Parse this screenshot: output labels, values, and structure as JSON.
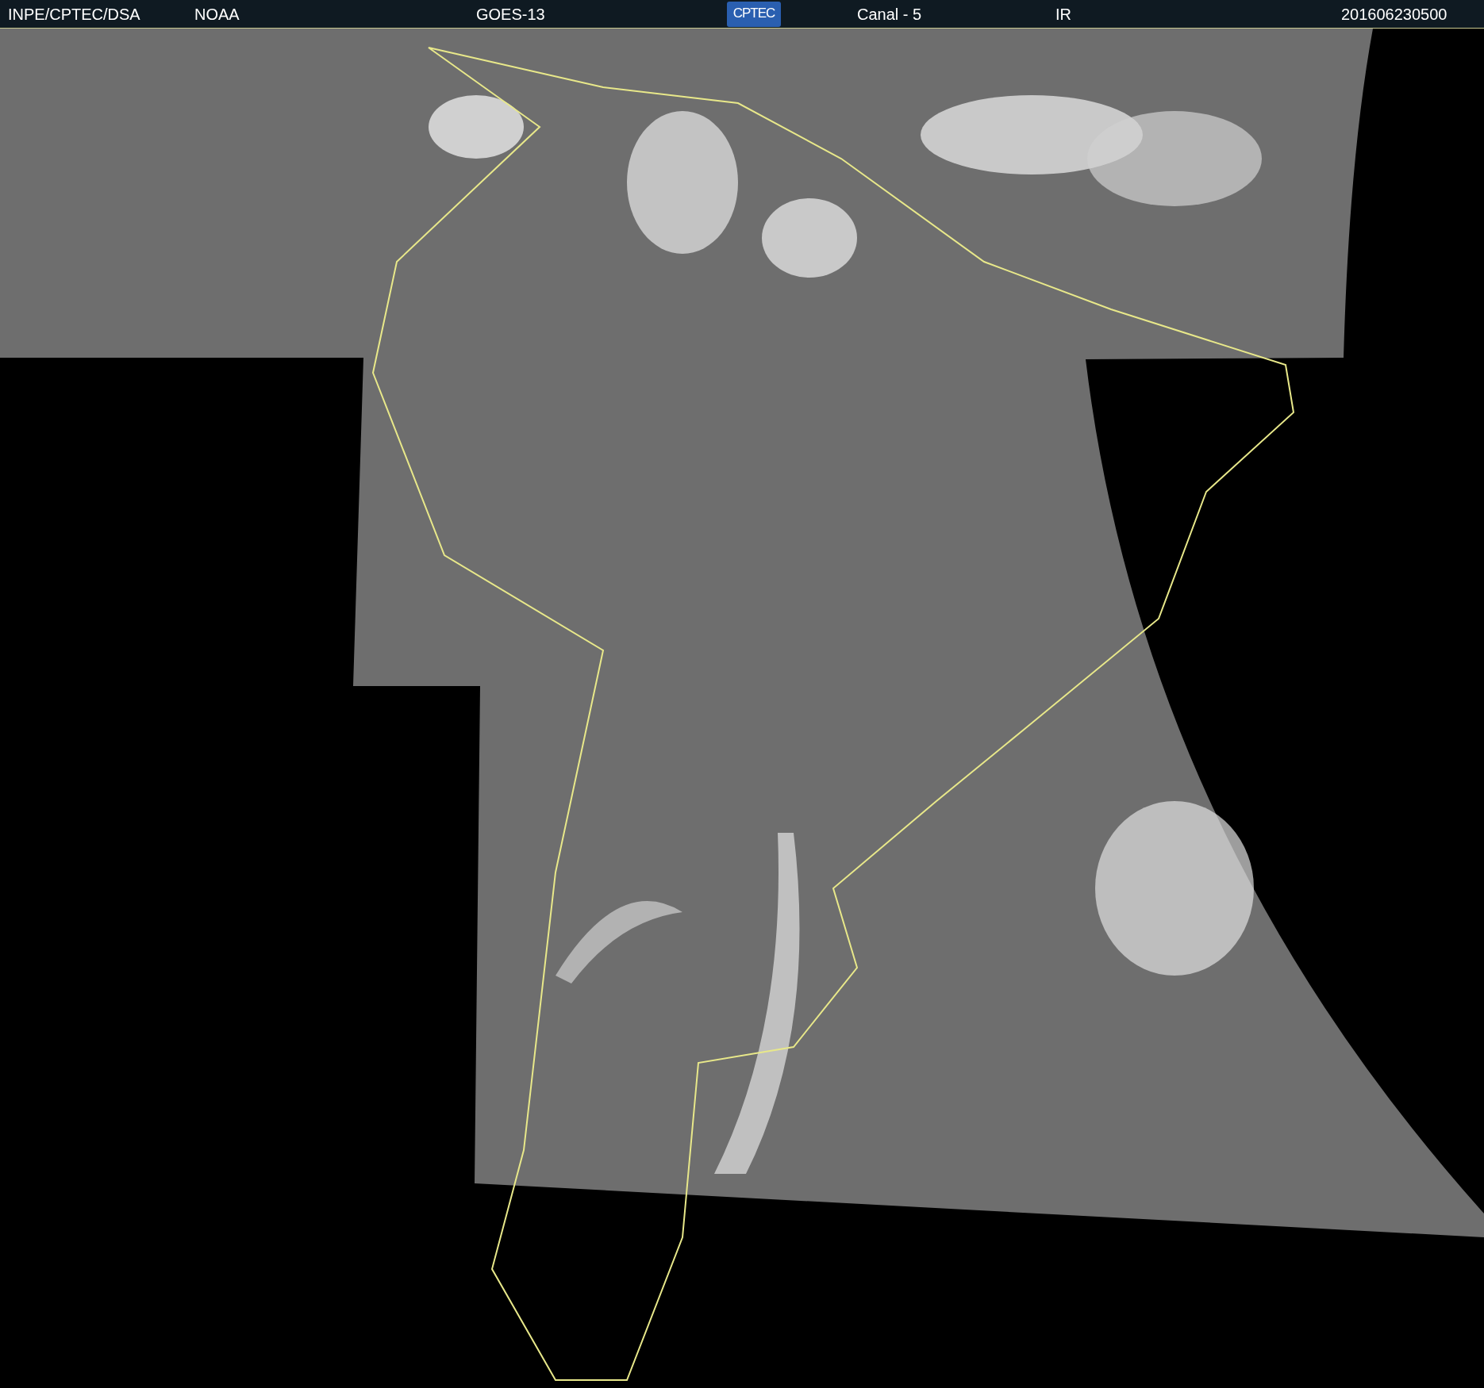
{
  "header": {
    "items": [
      {
        "kind": "text",
        "text": "INPE/CPTEC/DSA"
      },
      {
        "kind": "text",
        "text": "NOAA"
      },
      {
        "kind": "text",
        "text": "GOES-13"
      },
      {
        "kind": "logo",
        "text": "CPTEC"
      },
      {
        "kind": "text",
        "text": "Canal - 5"
      },
      {
        "kind": "text",
        "text": "IR"
      },
      {
        "kind": "text",
        "text": "201606230500"
      }
    ]
  }
}
